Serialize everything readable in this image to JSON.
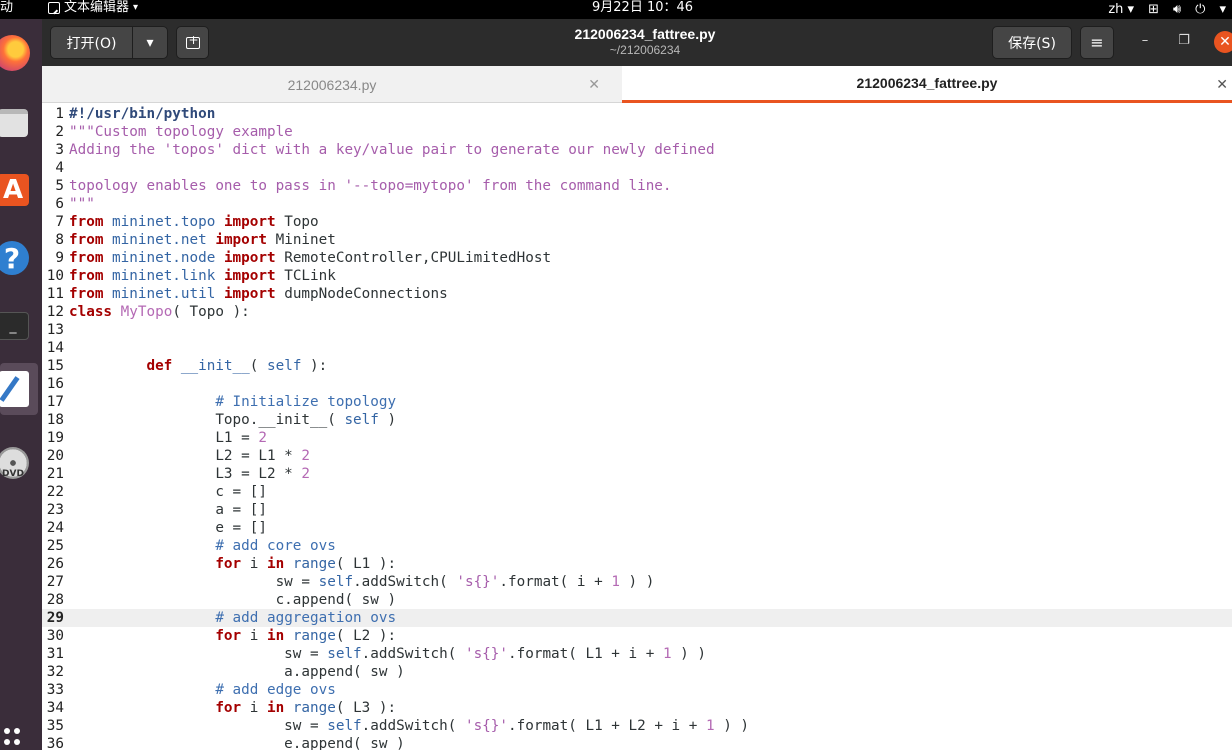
{
  "topbar": {
    "activities": "动",
    "app_name": "文本编辑器",
    "clock": "9月22日  10：46",
    "lang": "zh",
    "tray_arrow": "▾"
  },
  "dock": {
    "items": [
      "firefox-icon",
      "files-icon",
      "software-store-icon",
      "help-icon",
      "terminal-icon",
      "text-editor-icon",
      "dvd-icon"
    ]
  },
  "headerbar": {
    "open_label": "打开(O)",
    "save_label": "保存(S)",
    "title": "212006234_fattree.py",
    "subtitle": "~/212006234",
    "close_glyph": "✕",
    "min_glyph": "–",
    "max_glyph": "❐",
    "menu_glyph": "≡"
  },
  "tabs": [
    {
      "label": "212006234.py",
      "active": false
    },
    {
      "label": "212006234_fattree.py",
      "active": true
    }
  ],
  "editor": {
    "current_line": 29,
    "lines": [
      {
        "n": "1",
        "t": [
          [
            "pp",
            "#!/usr/bin/python"
          ]
        ]
      },
      {
        "n": "2",
        "t": [
          [
            "s",
            "\"\"\"Custom topology example"
          ]
        ]
      },
      {
        "n": "3",
        "t": [
          [
            "s",
            "Adding the 'topos' dict with a key/value pair to generate our newly defined"
          ]
        ]
      },
      {
        "n": "4",
        "t": []
      },
      {
        "n": "5",
        "t": [
          [
            "s",
            "topology enables one to pass in '--topo=mytopo' from the command line."
          ]
        ]
      },
      {
        "n": "6",
        "t": [
          [
            "s",
            "\"\"\""
          ]
        ]
      },
      {
        "n": "7",
        "t": [
          [
            "k",
            "from"
          ],
          [
            "",
            " "
          ],
          [
            "i",
            "mininet.topo"
          ],
          [
            "",
            " "
          ],
          [
            "k",
            "import"
          ],
          [
            "",
            " Topo"
          ]
        ]
      },
      {
        "n": "8",
        "t": [
          [
            "k",
            "from"
          ],
          [
            "",
            " "
          ],
          [
            "i",
            "mininet.net"
          ],
          [
            "",
            " "
          ],
          [
            "k",
            "import"
          ],
          [
            "",
            " Mininet"
          ]
        ]
      },
      {
        "n": "9",
        "t": [
          [
            "k",
            "from"
          ],
          [
            "",
            " "
          ],
          [
            "i",
            "mininet.node"
          ],
          [
            "",
            " "
          ],
          [
            "k",
            "import"
          ],
          [
            "",
            " RemoteController,CPULimitedHost"
          ]
        ]
      },
      {
        "n": "10",
        "t": [
          [
            "k",
            "from"
          ],
          [
            "",
            " "
          ],
          [
            "i",
            "mininet.link"
          ],
          [
            "",
            " "
          ],
          [
            "k",
            "import"
          ],
          [
            "",
            " TCLink"
          ]
        ]
      },
      {
        "n": "11",
        "t": [
          [
            "k",
            "from"
          ],
          [
            "",
            " "
          ],
          [
            "i",
            "mininet.util"
          ],
          [
            "",
            " "
          ],
          [
            "k",
            "import"
          ],
          [
            "",
            " dumpNodeConnections"
          ]
        ]
      },
      {
        "n": "12",
        "t": [
          [
            "k",
            "class"
          ],
          [
            "",
            " "
          ],
          [
            "n",
            "MyTopo"
          ],
          [
            "",
            "( Topo ):"
          ]
        ]
      },
      {
        "n": "13",
        "t": []
      },
      {
        "n": "14",
        "t": []
      },
      {
        "n": "15",
        "t": [
          [
            "",
            "         "
          ],
          [
            "k",
            "def"
          ],
          [
            "",
            " "
          ],
          [
            "i",
            "__init__"
          ],
          [
            "",
            "( "
          ],
          [
            "i",
            "self"
          ],
          [
            "",
            " ):"
          ]
        ]
      },
      {
        "n": "16",
        "t": []
      },
      {
        "n": "17",
        "t": [
          [
            "",
            "                 "
          ],
          [
            "c",
            "# Initialize topology"
          ]
        ]
      },
      {
        "n": "18",
        "t": [
          [
            "",
            "                 Topo.__init__( "
          ],
          [
            "i",
            "self"
          ],
          [
            "",
            " )"
          ]
        ]
      },
      {
        "n": "19",
        "t": [
          [
            "",
            "                 L1 = "
          ],
          [
            "n",
            "2"
          ]
        ]
      },
      {
        "n": "20",
        "t": [
          [
            "",
            "                 L2 = L1 * "
          ],
          [
            "n",
            "2"
          ]
        ]
      },
      {
        "n": "21",
        "t": [
          [
            "",
            "                 L3 = L2 * "
          ],
          [
            "n",
            "2"
          ]
        ]
      },
      {
        "n": "22",
        "t": [
          [
            "",
            "                 c = []"
          ]
        ]
      },
      {
        "n": "23",
        "t": [
          [
            "",
            "                 a = []"
          ]
        ]
      },
      {
        "n": "24",
        "t": [
          [
            "",
            "                 e = []"
          ]
        ]
      },
      {
        "n": "25",
        "t": [
          [
            "",
            "                 "
          ],
          [
            "c",
            "# add core ovs"
          ]
        ]
      },
      {
        "n": "26",
        "t": [
          [
            "",
            "                 "
          ],
          [
            "k",
            "for"
          ],
          [
            "",
            " i "
          ],
          [
            "k",
            "in"
          ],
          [
            "",
            " "
          ],
          [
            "i",
            "range"
          ],
          [
            "",
            "( L1 ):"
          ]
        ]
      },
      {
        "n": "27",
        "t": [
          [
            "",
            "                        sw = "
          ],
          [
            "i",
            "self"
          ],
          [
            "",
            ".addSwitch( "
          ],
          [
            "s",
            "'s{}'"
          ],
          [
            "",
            ".format( i + "
          ],
          [
            "n",
            "1"
          ],
          [
            "",
            " ) )"
          ]
        ]
      },
      {
        "n": "28",
        "t": [
          [
            "",
            "                        c.append( sw )"
          ]
        ]
      },
      {
        "n": "29",
        "t": [
          [
            "",
            "                 "
          ],
          [
            "c",
            "# add aggregation ovs"
          ]
        ]
      },
      {
        "n": "30",
        "t": [
          [
            "",
            "                 "
          ],
          [
            "k",
            "for"
          ],
          [
            "",
            " i "
          ],
          [
            "k",
            "in"
          ],
          [
            "",
            " "
          ],
          [
            "i",
            "range"
          ],
          [
            "",
            "( L2 ):"
          ]
        ]
      },
      {
        "n": "31",
        "t": [
          [
            "",
            "                         sw = "
          ],
          [
            "i",
            "self"
          ],
          [
            "",
            ".addSwitch( "
          ],
          [
            "s",
            "'s{}'"
          ],
          [
            "",
            ".format( L1 + i + "
          ],
          [
            "n",
            "1"
          ],
          [
            "",
            " ) )"
          ]
        ]
      },
      {
        "n": "32",
        "t": [
          [
            "",
            "                         a.append( sw )"
          ]
        ]
      },
      {
        "n": "33",
        "t": [
          [
            "",
            "                 "
          ],
          [
            "c",
            "# add edge ovs"
          ]
        ]
      },
      {
        "n": "34",
        "t": [
          [
            "",
            "                 "
          ],
          [
            "k",
            "for"
          ],
          [
            "",
            " i "
          ],
          [
            "k",
            "in"
          ],
          [
            "",
            " "
          ],
          [
            "i",
            "range"
          ],
          [
            "",
            "( L3 ):"
          ]
        ]
      },
      {
        "n": "35",
        "t": [
          [
            "",
            "                         sw = "
          ],
          [
            "i",
            "self"
          ],
          [
            "",
            ".addSwitch( "
          ],
          [
            "s",
            "'s{}'"
          ],
          [
            "",
            ".format( L1 + L2 + i + "
          ],
          [
            "n",
            "1"
          ],
          [
            "",
            " ) )"
          ]
        ]
      },
      {
        "n": "36",
        "t": [
          [
            "",
            "                         e.append( sw )"
          ]
        ]
      }
    ]
  }
}
